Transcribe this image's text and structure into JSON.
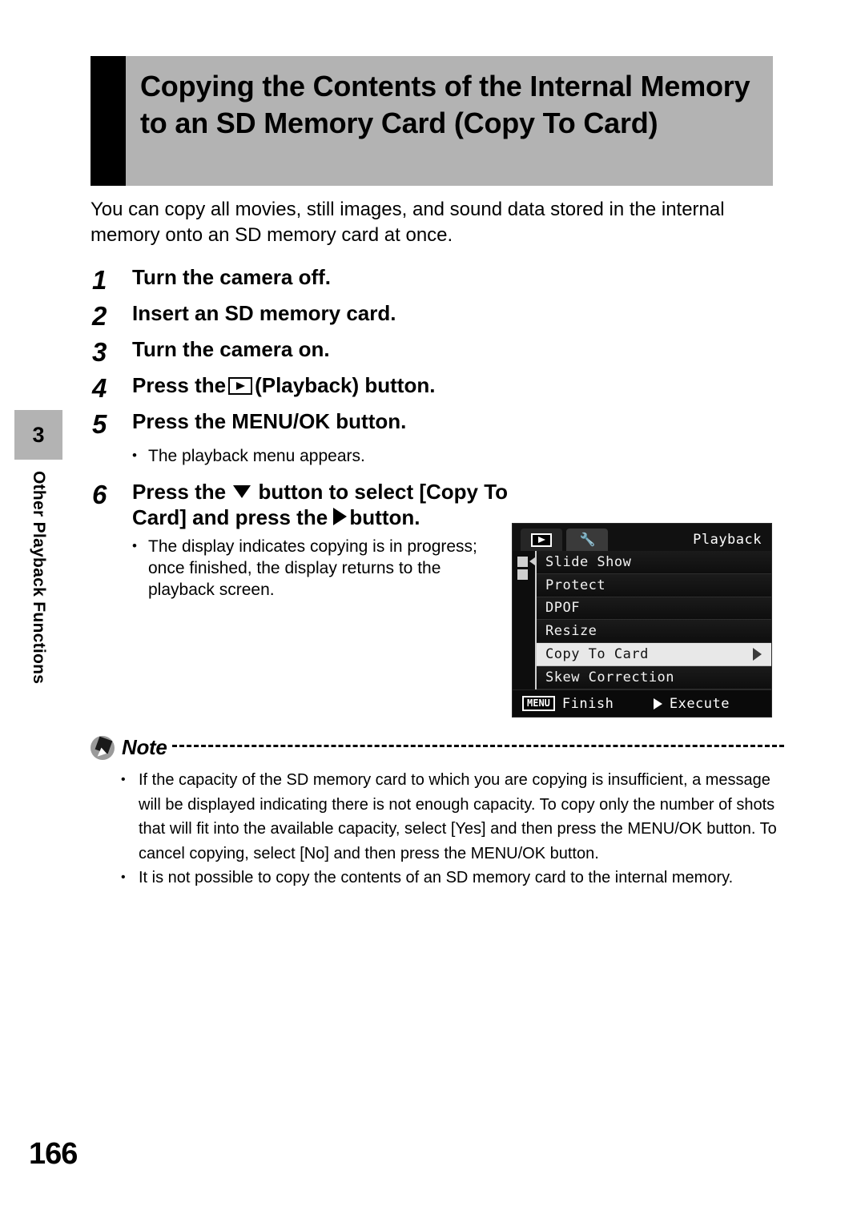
{
  "sidebar": {
    "chapter_number": "3",
    "chapter_label": "Other Playback Functions"
  },
  "header": {
    "title": "Copying the Contents of the Internal Memory to an SD Memory Card (Copy To Card)"
  },
  "intro": "You can copy all movies, still images, and sound data stored in the internal memory onto an SD memory card at once.",
  "steps": [
    {
      "num": "1",
      "text": "Turn the camera off."
    },
    {
      "num": "2",
      "text": "Insert an SD memory card."
    },
    {
      "num": "3",
      "text": "Turn the camera on."
    },
    {
      "num": "4",
      "text_before": "Press the",
      "icon": "playback-icon",
      "text_after": "(Playback) button."
    },
    {
      "num": "5",
      "text": "Press the MENU/OK button.",
      "bullets": [
        "The playback menu appears."
      ]
    },
    {
      "num": "6",
      "text_a": "Press the",
      "icon_down": "down-arrow-icon",
      "text_b": "button to select [Copy To Card] and press the",
      "icon_right": "right-arrow-icon",
      "text_c": "button.",
      "bullets": [
        "The display indicates copying is in progress; once finished, the display returns to the playback screen."
      ]
    }
  ],
  "lcd": {
    "tabs": [
      {
        "icon": "playback-tab-icon",
        "active": true
      },
      {
        "icon": "setup-tools-tab-icon",
        "active": false
      }
    ],
    "mode_label": "Playback",
    "menu_items": [
      {
        "label": "Slide Show",
        "selected": false
      },
      {
        "label": "Protect",
        "selected": false
      },
      {
        "label": "DPOF",
        "selected": false
      },
      {
        "label": "Resize",
        "selected": false
      },
      {
        "label": "Copy To Card",
        "selected": true
      },
      {
        "label": "Skew Correction",
        "selected": false
      }
    ],
    "footer": {
      "menu_chip": "MENU",
      "finish_label": "Finish",
      "execute_label": "Execute"
    }
  },
  "note": {
    "title": "Note",
    "bullets": [
      "If the capacity of the SD memory card to which you are copying is insufficient, a message will be displayed indicating there is not enough capacity. To copy only the number of shots that will fit into the available capacity, select [Yes] and then press the MENU/OK button. To cancel copying, select [No] and then press the MENU/OK button.",
      "It is not possible to copy the contents of an SD memory card to the internal memory."
    ]
  },
  "page_number": "166",
  "bullet_char": "•"
}
